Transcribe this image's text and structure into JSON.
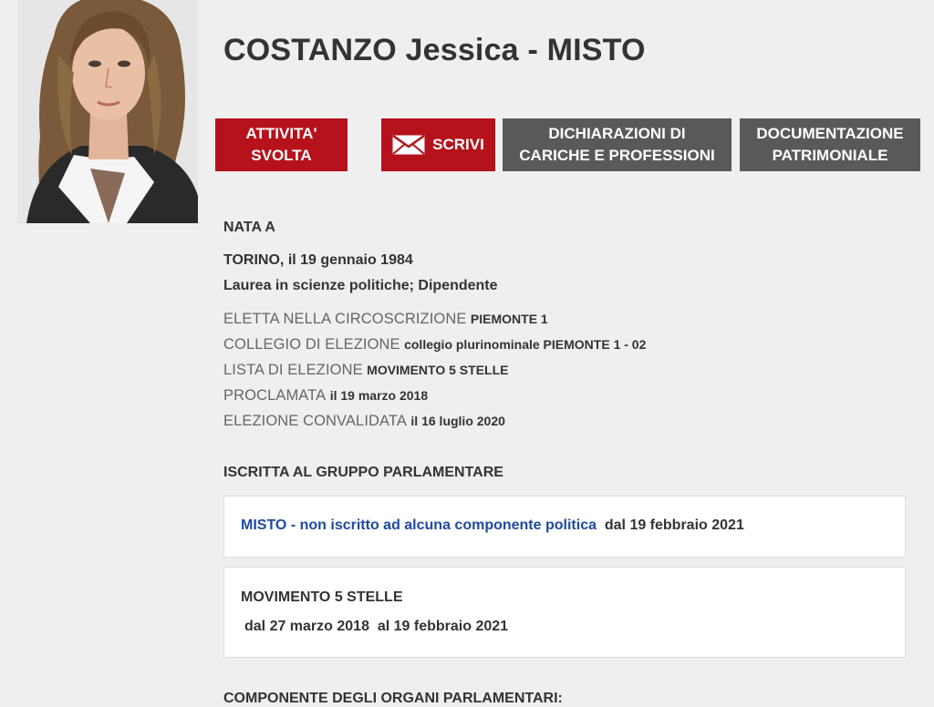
{
  "profile": {
    "name": "COSTANZO Jessica - MISTO"
  },
  "buttons": {
    "activity": "ATTIVITA' SVOLTA",
    "write": "SCRIVI",
    "declarations_line1": "DICHIARAZIONI DI",
    "declarations_line2": "CARICHE E PROFESSIONI",
    "documentation_line1": "DOCUMENTAZIONE",
    "documentation_line2": "PATRIMONIALE"
  },
  "birth": {
    "heading": "NATA A",
    "place_date": "TORINO, il 19 gennaio 1984",
    "education_job": "Laurea in scienze politiche; Dipendente"
  },
  "election": {
    "circoscrizione_label": "ELETTA NELLA CIRCOSCRIZIONE",
    "circoscrizione_value": "PIEMONTE 1",
    "collegio_label": "COLLEGIO DI ELEZIONE",
    "collegio_value": "collegio plurinominale PIEMONTE 1 - 02",
    "lista_label": "LISTA DI ELEZIONE",
    "lista_value": "MOVIMENTO 5 STELLE",
    "proclamata_label": "PROCLAMATA",
    "proclamata_value": "il 19 marzo 2018",
    "convalidata_label": "ELEZIONE CONVALIDATA",
    "convalidata_value": "il 16 luglio 2020"
  },
  "group": {
    "heading": "ISCRITTA AL GRUPPO PARLAMENTARE",
    "current_link_group": "MISTO",
    "current_separator": "-",
    "current_link_component": "non iscritto ad alcuna componente politica",
    "current_since": "dal 19 febbraio 2021",
    "previous_name": "MOVIMENTO 5 STELLE",
    "previous_period": "dal 27 marzo 2018  al 19 febbraio 2021"
  },
  "organs": {
    "heading": "COMPONENTE DEGLI ORGANI PARLAMENTARI:"
  },
  "icons": {
    "mail": "envelope-icon"
  },
  "colors": {
    "red": "#b5121b",
    "gray": "#595959",
    "link": "#1f4aa0",
    "background": "#efefef"
  }
}
